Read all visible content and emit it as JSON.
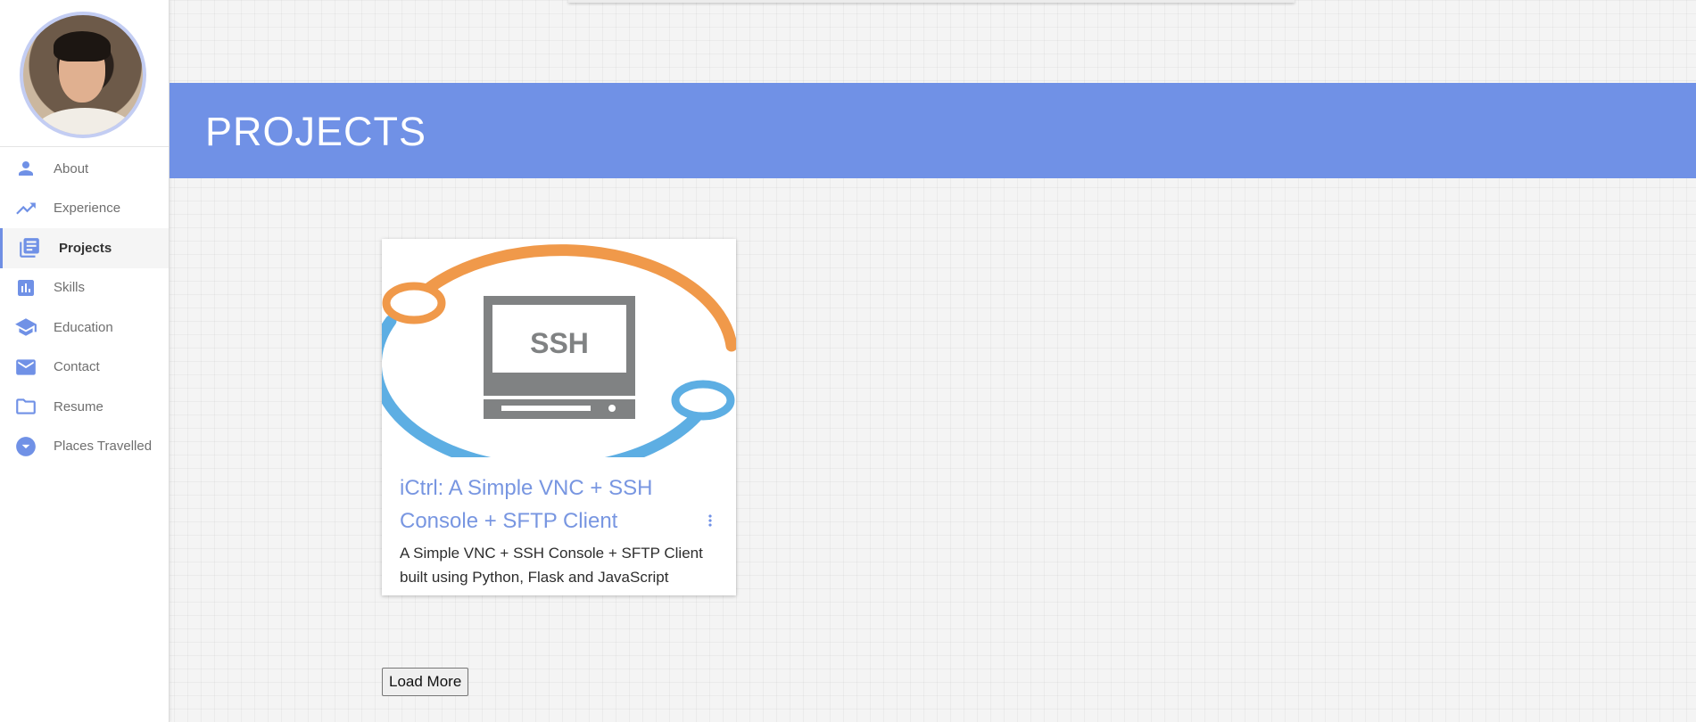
{
  "sidebar": {
    "avatar_alt": "Profile photo",
    "items": [
      {
        "label": "About",
        "icon": "person-icon"
      },
      {
        "label": "Experience",
        "icon": "trending-up-icon"
      },
      {
        "label": "Projects",
        "icon": "library-books-icon",
        "active": true
      },
      {
        "label": "Skills",
        "icon": "bar-chart-icon"
      },
      {
        "label": "Education",
        "icon": "school-icon"
      },
      {
        "label": "Contact",
        "icon": "mail-icon"
      },
      {
        "label": "Resume",
        "icon": "folder-icon"
      },
      {
        "label": "Places Travelled",
        "icon": "arrow-drop-down-circle-icon"
      }
    ]
  },
  "banner": {
    "title": "PROJECTS"
  },
  "projects": [
    {
      "image_text": "SSH",
      "title": "iCtrl: A Simple VNC + SSH Console + SFTP Client",
      "description": "A Simple VNC + SSH Console + SFTP Client built using Python, Flask and JavaScript"
    }
  ],
  "load_more_label": "Load More",
  "colors": {
    "accent": "#7091e6",
    "title": "#7896e1",
    "orange": "#f0994a",
    "blue": "#5daee3",
    "grey": "#808283"
  }
}
